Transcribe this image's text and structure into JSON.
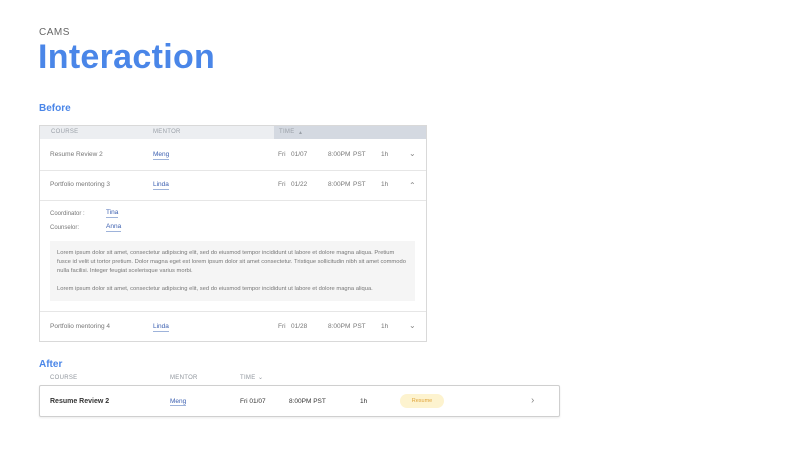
{
  "header": {
    "eyebrow": "CAMS",
    "title": "Interaction"
  },
  "before": {
    "section_label": "Before",
    "columns": [
      "COURSE",
      "MENTOR",
      "TIME"
    ],
    "sort_indicator": "▲",
    "rows": [
      {
        "course": "Resume Review 2",
        "mentor": "Meng",
        "day": "Fri",
        "date": "01/07",
        "time": "8:00PM",
        "tz": "PST",
        "duration": "1h",
        "chevron": "⌄"
      },
      {
        "course": "Portfolio mentoring 3",
        "mentor": "Linda",
        "day": "Fri",
        "date": "01/22",
        "time": "8:00PM",
        "tz": "PST",
        "duration": "1h",
        "chevron": "⌃"
      },
      {
        "course": "Portfolio mentoring 4",
        "mentor": "Linda",
        "day": "Fri",
        "date": "01/28",
        "time": "8:00PM",
        "tz": "PST",
        "duration": "1h",
        "chevron": "⌄"
      }
    ],
    "expanded": {
      "coordinator_label": "Coordinator :",
      "coordinator": "Tina",
      "counselor_label": "Counselor:",
      "counselor": "Anna",
      "note_p1": "Lorem ipsum dolor sit amet, consectetur adipiscing elit, sed do eiusmod tempor incididunt ut labore et dolore magna aliqua. Pretium fusce id velit ut tortor pretium. Dolor magna eget est lorem ipsum dolor sit amet consectetur. Tristique sollicitudin nibh sit amet commodo nulla facilisi. Integer feugiat scelerisque varius morbi.",
      "note_p2": "Lorem ipsum dolor sit amet, consectetur adipiscing elit, sed do eiusmod tempor incididunt ut labore et dolore magna aliqua."
    }
  },
  "after": {
    "section_label": "After",
    "columns": [
      "COURSE",
      "MENTOR",
      "TIME"
    ],
    "sort_indicator": "⌄",
    "row": {
      "course": "Resume Review 2",
      "mentor": "Meng",
      "day_date": "Fri 01/07",
      "time": "8:00PM PST",
      "duration": "1h",
      "action": "Resume",
      "chevron": "›"
    }
  },
  "colors": {
    "accent": "#4a86e8",
    "link": "#3b5fb0",
    "pill_bg": "#fdf3cf",
    "pill_text": "#e0a43a"
  }
}
